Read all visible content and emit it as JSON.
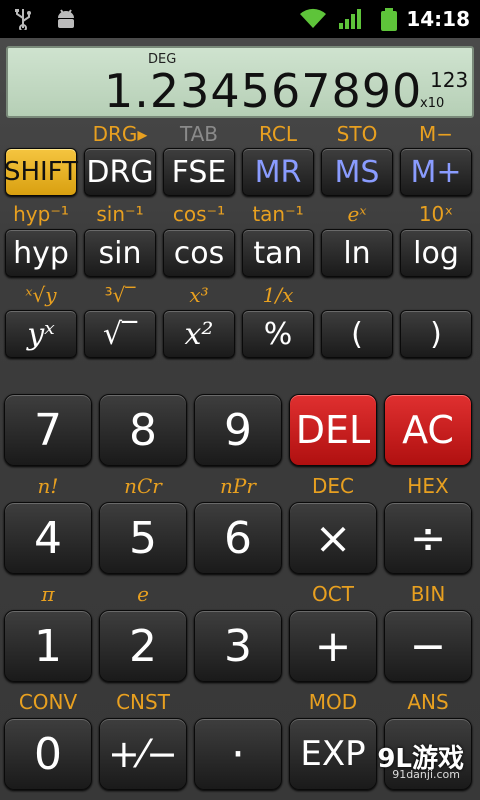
{
  "status_bar": {
    "time": "14:18",
    "icons": [
      "usb-icon",
      "android-debug-icon",
      "wifi-icon",
      "signal-icon",
      "battery-icon"
    ]
  },
  "display": {
    "mode": "DEG",
    "value": "1.234567890",
    "exponent": "123",
    "x10": "x10"
  },
  "row1": {
    "labels": [
      "DRG▸",
      "TAB",
      "RCL",
      "STO",
      "M−"
    ],
    "keys": [
      "SHIFT",
      "DRG",
      "FSE",
      "MR",
      "MS",
      "M+"
    ]
  },
  "row2": {
    "labels": [
      "hyp⁻¹",
      "sin⁻¹",
      "cos⁻¹",
      "tan⁻¹",
      "eˣ",
      "10ˣ"
    ],
    "keys": [
      "hyp",
      "sin",
      "cos",
      "tan",
      "ln",
      "log"
    ]
  },
  "row3": {
    "labels": [
      "ˣ√y",
      "³√‾",
      "x³",
      "1/x"
    ],
    "keys": [
      "yˣ",
      "√‾",
      "x²",
      "%",
      "(",
      ")"
    ]
  },
  "num1": {
    "keys": [
      "7",
      "8",
      "9",
      "DEL",
      "AC"
    ]
  },
  "num2": {
    "labels": [
      "n!",
      "nCr",
      "nPr",
      "DEC",
      "HEX"
    ],
    "keys": [
      "4",
      "5",
      "6",
      "×",
      "÷"
    ]
  },
  "num3": {
    "labels": [
      "π",
      "e",
      "OCT",
      "BIN"
    ],
    "keys": [
      "1",
      "2",
      "3",
      "+",
      "−"
    ]
  },
  "num4": {
    "labels": [
      "CONV",
      "CNST",
      "MOD",
      "ANS"
    ],
    "keys": [
      "0",
      "+⁄−",
      "·",
      "EXP"
    ]
  },
  "watermark": {
    "main": "9L游戏",
    "sub": "91danji.com"
  },
  "colors": {
    "shift": "#e8b020",
    "label": "#e8a020",
    "memory": "#8a9cff",
    "red": "#c81818",
    "display": "#c4dbc4"
  }
}
